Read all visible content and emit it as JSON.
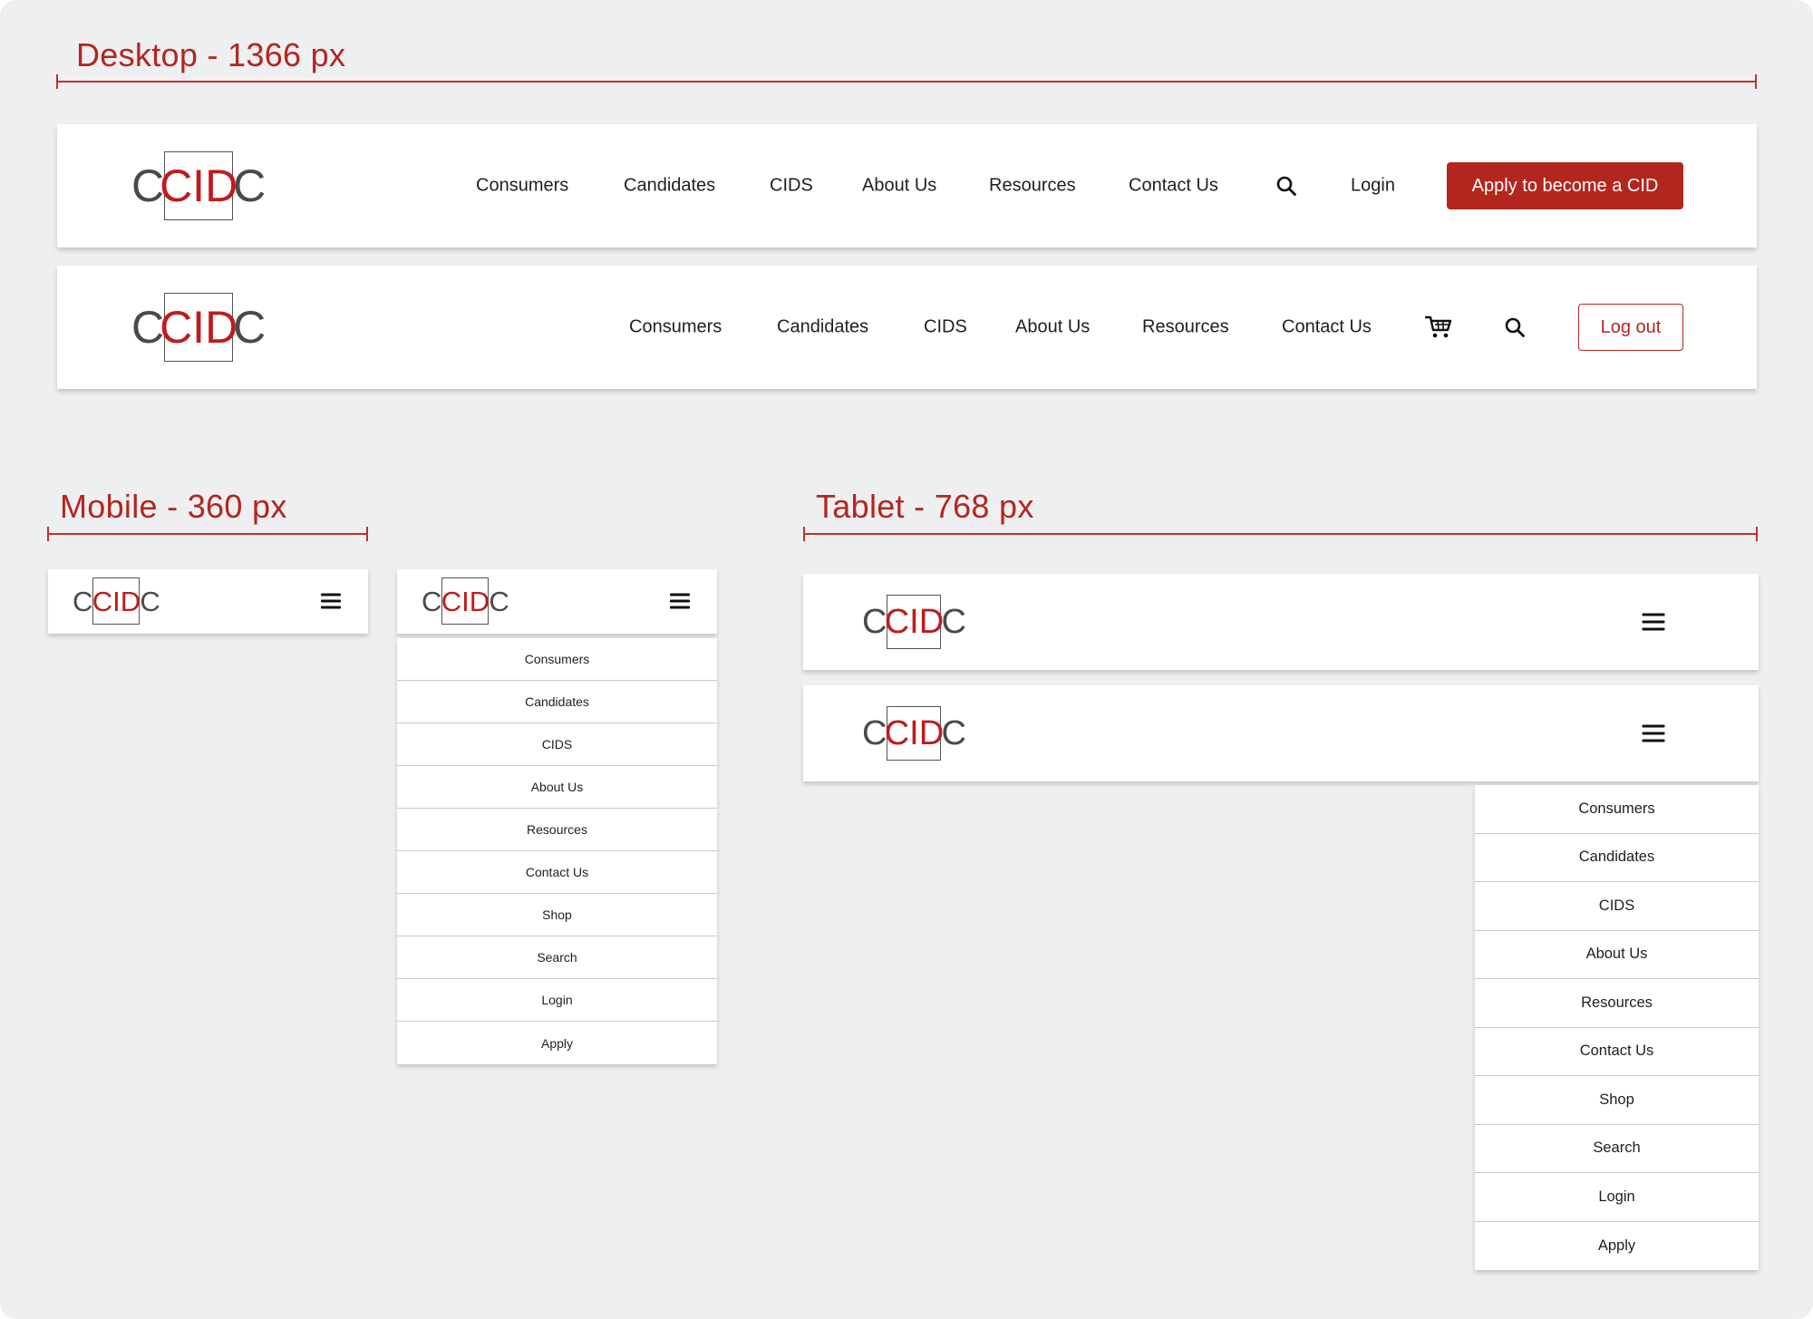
{
  "sections": {
    "desktop": "Desktop - 1366 px",
    "mobile": "Mobile - 360 px",
    "tablet": "Tablet - 768 px"
  },
  "logo": {
    "left": "C",
    "middle": "CID",
    "right": "C"
  },
  "desktop_logged_out": {
    "nav": [
      "Consumers",
      "Candidates",
      "CIDS",
      "About Us",
      "Resources",
      "Contact Us"
    ],
    "search_icon": "search-icon",
    "login": "Login",
    "apply_button": "Apply to become a CID"
  },
  "desktop_logged_in": {
    "nav": [
      "Consumers",
      "Candidates",
      "CIDS",
      "About Us",
      "Resources",
      "Contact Us"
    ],
    "cart_icon": "cart-icon",
    "search_icon": "search-icon",
    "logout_button": "Log out"
  },
  "mobile_menu": [
    "Consumers",
    "Candidates",
    "CIDS",
    "About Us",
    "Resources",
    "Contact Us",
    "Shop",
    "Search",
    "Login",
    "Apply"
  ],
  "tablet_menu": [
    "Consumers",
    "Candidates",
    "CIDS",
    "About Us",
    "Resources",
    "Contact Us",
    "Shop",
    "Search",
    "Login",
    "Apply"
  ],
  "colors": {
    "accent": "#b3261e",
    "background": "#eeeff1",
    "text": "#1f1f1f"
  }
}
